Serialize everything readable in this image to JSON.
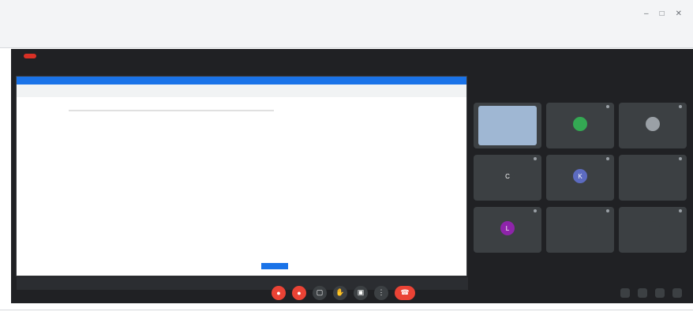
{
  "meet": {
    "tiles": [
      {
        "avatar_color": "#34a853",
        "avatar_letter": ""
      },
      {
        "avatar_color": "#9aa0a6",
        "avatar_letter": ""
      },
      {
        "avatar_color": "#3c4043",
        "avatar_letter": "C"
      },
      {
        "avatar_color": "#5c6bc0",
        "avatar_letter": "K"
      },
      {
        "avatar_color": "#3c4043",
        "avatar_letter": ""
      },
      {
        "avatar_color": "#8e24aa",
        "avatar_letter": "L"
      },
      {
        "avatar_color": "#3c4043",
        "avatar_letter": ""
      },
      {
        "avatar_color": "#3c4043",
        "avatar_letter": ""
      }
    ]
  },
  "colors": {
    "meet_bg": "#202124",
    "end_call": "#ea4335",
    "accent": "#1a73e8"
  }
}
